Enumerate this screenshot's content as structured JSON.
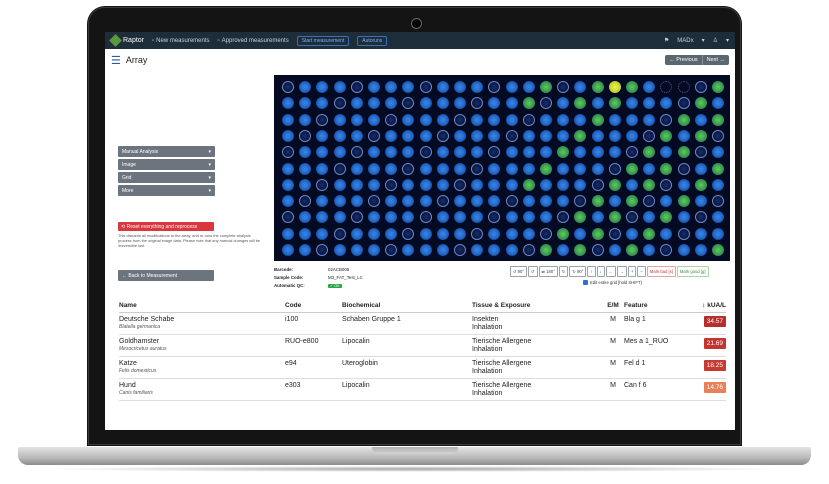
{
  "app": {
    "brand": "Raptor",
    "nav": [
      "New measurements",
      "Approved measurements"
    ],
    "nav_buttons": [
      "Start measurement",
      "Autoruns"
    ],
    "user": "MADx",
    "icons": {
      "brand": "raptor-logo-icon",
      "user": "user-icon",
      "flag": "flag-icon"
    }
  },
  "page": {
    "title": "Array",
    "prev_label": "← Previous",
    "next_label": "Next →"
  },
  "sidebar": {
    "sections": [
      "Manual Analysis",
      "Image",
      "Grid",
      "More"
    ],
    "reset_label": "Reset everything and reprocess",
    "reset_note": "This discards all modifications to the array, and re-runs the complete analysis process from the original image data. Please note that any manual changes will be irreversible lost.",
    "back_label": "← Back to Measurement"
  },
  "meta": {
    "barcode_label": "Barcode:",
    "barcode": "02ACB005",
    "sample_label": "Sample Code:",
    "sample": "M3_FAT_Test_LC",
    "qc_label": "Automatic QC:",
    "qc": "✓ OK"
  },
  "toolbar": {
    "buttons": [
      "↺ 90°",
      "↺",
      "⇄ 180°",
      "↻",
      "↻ 90°",
      "↑",
      "↓",
      "←",
      "→",
      "+",
      "−"
    ],
    "mark_bad": "Mark bad [s]",
    "mark_good": "Mark good [g]",
    "edit_grid": "Edit entire grid [hold SHIFT]"
  },
  "table": {
    "headers": [
      "Name",
      "Code",
      "Biochemical",
      "Tissue & Exposure",
      "E/M",
      "Feature",
      "↕ kUA/L"
    ],
    "rows": [
      {
        "name": "Deutsche Schabe",
        "sci": "Blatella germanica",
        "code": "i100",
        "biochemical": "Schaben Gruppe 1",
        "tissue": "Insekten",
        "exposure": "Inhalation",
        "em": "M",
        "feature": "Bla g 1",
        "value": "34.57",
        "color": "#b82e2e"
      },
      {
        "name": "Goldhamster",
        "sci": "Mesocricetus auratus",
        "code": "RUO-e800",
        "biochemical": "Lipocalin",
        "tissue": "Tierische Allergene",
        "exposure": "Inhalation",
        "em": "M",
        "feature": "Mes a 1_RUO",
        "value": "21.69",
        "color": "#c23530"
      },
      {
        "name": "Katze",
        "sci": "Felis domesticus",
        "code": "e94",
        "biochemical": "Uteroglobin",
        "tissue": "Tierische Allergene",
        "exposure": "Inhalation",
        "em": "M",
        "feature": "Fel d 1",
        "value": "18.25",
        "color": "#c73933"
      },
      {
        "name": "Hund",
        "sci": "Canis familiaris",
        "code": "e303",
        "biochemical": "Lipocalin",
        "tissue": "Tierische Allergene",
        "exposure": "Inhalation",
        "em": "M",
        "feature": "Can f 6",
        "value": "14.76",
        "color": "#e8805a"
      }
    ]
  },
  "colors": {
    "topbar": "#1e2d3a",
    "accent": "#2a5d9f",
    "array_background": "#040a22",
    "spot_blue": "#1f66c9",
    "spot_green": "#5fce4a",
    "spot_yellow": "#f0f24a"
  }
}
